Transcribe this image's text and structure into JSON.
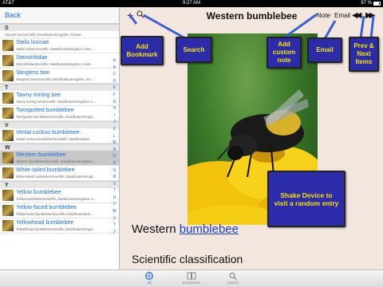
{
  "status": {
    "carrier": "AT&T",
    "time": "9:27 AM",
    "battery": "97 %"
  },
  "nav": {
    "back_label": "Back"
  },
  "list": {
    "rows": [
      {
        "type": "section",
        "label": "S"
      },
      {
        "type": "short",
        "subtitle": "Squash beeScientific classificationKingdom: Animal..."
      },
      {
        "type": "item",
        "title": "Stelis louisae",
        "subtitle": "Stelis louisaeScientific classificationKingdom: Anim..."
      },
      {
        "type": "item",
        "title": "Stenotritidae",
        "subtitle": "StenotritidaeScientific classificationKingdom: Anim..."
      },
      {
        "type": "item",
        "title": "Stingless bee",
        "subtitle": "Stingless beesScientific classificationKingdom: Ani..."
      },
      {
        "type": "section",
        "label": "T"
      },
      {
        "type": "item",
        "title": "Tawny mining bee",
        "subtitle": "Tawny mining beeScientific classificationKingdom: A..."
      },
      {
        "type": "item",
        "title": "Twospotted bumblebee",
        "subtitle": "Twospotted bumblebeeScientific classificationKingd..."
      },
      {
        "type": "section",
        "label": "V"
      },
      {
        "type": "item",
        "title": "Vestal cuckoo bumblebee",
        "subtitle": "Vestal cuckoo bumblebeeScientific classificationK..."
      },
      {
        "type": "section",
        "label": "W"
      },
      {
        "type": "item",
        "title": "Western bumblebee",
        "subtitle": "Western bumblebeeScientific classificationKingdom:...",
        "selected": true
      },
      {
        "type": "item",
        "title": "White-tailed bumblebee",
        "subtitle": "White-tailed bumblebeeScientific classificationKingd..."
      },
      {
        "type": "section",
        "label": "Y"
      },
      {
        "type": "item",
        "title": "Yellow bumblebee",
        "subtitle": "Yellow bumblebeeScientific classificationKingdom: A..."
      },
      {
        "type": "item",
        "title": "Yellow-faced bumblebee",
        "subtitle": "Yellow-faced bumblebeeScientific classificationKin..."
      },
      {
        "type": "item",
        "title": "Yellowhead bumblebee",
        "subtitle": "Yellowhead bumblebeeScientific classificationKingd..."
      }
    ],
    "index_letters": [
      "A",
      "B",
      "C",
      "D",
      "E",
      "F",
      "G",
      "H",
      "I",
      "J",
      "K",
      "L",
      "M",
      "N",
      "O",
      "P",
      "Q",
      "R",
      "S",
      "T",
      "U",
      "V",
      "W",
      "X",
      "Y",
      "Z"
    ]
  },
  "toolbar": {
    "plus": "+",
    "title": "Western bumblebee",
    "note": "Note",
    "email": "Email",
    "prev": "◀◀",
    "next": "▶▶"
  },
  "article": {
    "title_prefix": "Western",
    "title_link": "bumblebee",
    "section": "Scientific classification"
  },
  "callouts": {
    "bookmark": "Add Bookmark",
    "search": "Search",
    "note": "Add custom note",
    "email": "Email",
    "prevnext": "Prev & Next Items",
    "shake": "Shake Device to visit a random entry"
  },
  "tabs": [
    {
      "label": "All",
      "icon": "all-icon",
      "active": true
    },
    {
      "label": "Bookmarks",
      "icon": "bookmarks-icon",
      "active": false
    },
    {
      "label": "Search",
      "icon": "search-icon",
      "active": false
    }
  ],
  "colors": {
    "link": "#1a6ed8",
    "callout_bg": "#2c2caa",
    "callout_text": "#f7e400",
    "selected_row": "#c8c8c8"
  }
}
